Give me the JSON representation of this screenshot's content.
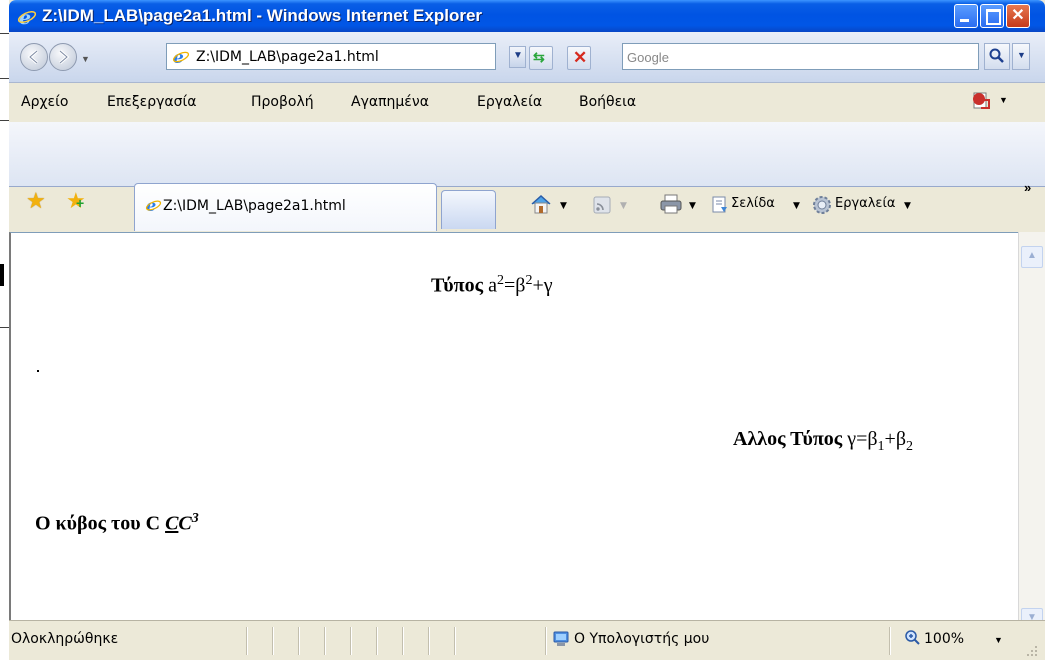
{
  "window": {
    "title": "Z:\\IDM_LAB\\page2a1.html - Windows Internet Explorer"
  },
  "address_bar": {
    "url": "Z:\\IDM_LAB\\page2a1.html"
  },
  "search": {
    "placeholder": "Google"
  },
  "menu": {
    "items": [
      "Αρχείο",
      "Επεξεργασία",
      "Προβολή",
      "Αγαπημένα",
      "Εργαλεία",
      "Βοήθεια"
    ]
  },
  "tabs": {
    "active_label": "Z:\\IDM_LAB\\page2a1.html"
  },
  "command_bar": {
    "page_label": "Σελίδα",
    "tools_label": "Εργαλεία"
  },
  "content": {
    "formula1": {
      "label": "Τύπος",
      "a": "a",
      "sup1": "2",
      "eq": "=β",
      "sup2": "2",
      "rest": "+γ"
    },
    "formula2": {
      "label": "Αλλος Τύπος",
      "lhs": "γ=β",
      "sub1": "1",
      "plus": "+β",
      "sub2": "2"
    },
    "formula3": {
      "label": "Ο κύβος του C",
      "c_under": "C",
      "c_italic": "C",
      "sup": "3"
    }
  },
  "status_bar": {
    "status_text": "Ολοκληρώθηκε",
    "zone_text": "Ο Υπολογιστής μου",
    "zoom": "100%"
  },
  "icons": {
    "browser": "ie-icon",
    "back": "back-arrow-icon",
    "forward": "forward-arrow-icon",
    "refresh": "refresh-icon",
    "stop": "stop-icon",
    "search": "search-icon",
    "favorites": "star-icon",
    "add_favorites": "add-favorite-icon",
    "home": "home-icon",
    "feeds": "rss-icon",
    "print": "print-icon",
    "page": "page-icon",
    "tools": "gear-icon",
    "pdf": "pdf-icon",
    "zone": "computer-icon",
    "zoom": "zoom-icon"
  }
}
